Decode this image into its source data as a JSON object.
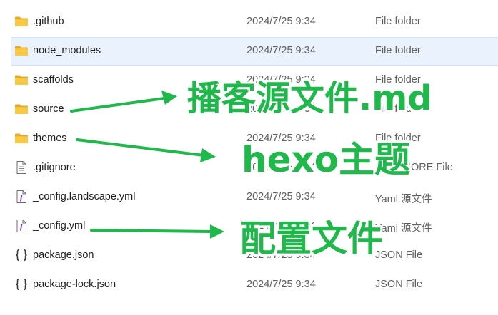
{
  "files": [
    {
      "name": ".github",
      "date": "2024/7/25 9:34",
      "type": "File folder",
      "icon": "folder-icon",
      "selected": false
    },
    {
      "name": "node_modules",
      "date": "2024/7/25 9:34",
      "type": "File folder",
      "icon": "folder-icon",
      "selected": true
    },
    {
      "name": "scaffolds",
      "date": "2024/7/25 9:34",
      "type": "File folder",
      "icon": "folder-icon",
      "selected": false
    },
    {
      "name": "source",
      "date": "2024/7/25 9:34",
      "type": "File folder",
      "icon": "folder-icon",
      "selected": false
    },
    {
      "name": "themes",
      "date": "2024/7/25 9:34",
      "type": "File folder",
      "icon": "folder-icon",
      "selected": false
    },
    {
      "name": ".gitignore",
      "date": "2024/7/25 9:34",
      "type": "GITIGNORE File",
      "icon": "text-file-icon",
      "selected": false
    },
    {
      "name": "_config.landscape.yml",
      "date": "2024/7/25 9:34",
      "type": "Yaml 源文件",
      "icon": "yaml-file-icon",
      "selected": false
    },
    {
      "name": "_config.yml",
      "date": "2024/7/25 9:34",
      "type": "Yaml 源文件",
      "icon": "yaml-file-icon",
      "selected": false
    },
    {
      "name": "package.json",
      "date": "2024/7/25 9:34",
      "type": "JSON File",
      "icon": "json-file-icon",
      "selected": false
    },
    {
      "name": "package-lock.json",
      "date": "2024/7/25 9:34",
      "type": "JSON File",
      "icon": "json-file-icon",
      "selected": false
    }
  ],
  "annotations": [
    {
      "text": "播客源文件.md",
      "points_to": "source"
    },
    {
      "text": "hexo主题",
      "points_to": "themes"
    },
    {
      "text": "配置文件",
      "points_to": "_config.yml"
    }
  ],
  "colors": {
    "annotation": "#1fb84a",
    "folder": "#f5c243",
    "selection": "#eaf3fd"
  }
}
